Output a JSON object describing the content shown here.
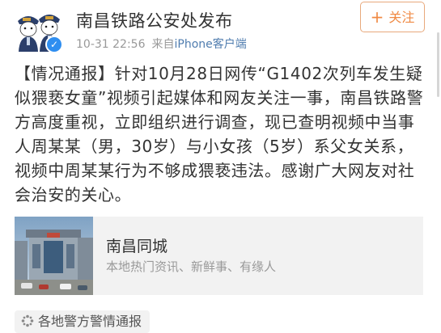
{
  "post": {
    "author_name": "南昌铁路公安处发布",
    "timestamp": "10-31 22:56",
    "source_prefix": "来自",
    "source_client": "iPhone客户端",
    "follow_label": "关注",
    "text": "【情况通报】针对10月28日网传“G1402次列车发生疑似猥亵女童”视频引起媒体和网友关注一事，南昌铁路警方高度重视，立即组织进行调查，现已查明视频中当事人周某某（男，30岁）与小女孩（5岁）系父女关系，视频中周某某行为不够成猥亵违法。感谢广大网友对社会治安的关心。"
  },
  "card": {
    "title": "南昌同城",
    "description": "本地热门资讯、新鲜事、有缘人"
  },
  "topic_tag": {
    "label": "各地警方警情通报",
    "icon": "flower-dots-icon"
  },
  "colors": {
    "follow_orange": "#f08a44",
    "verified_blue": "#2f8ef0",
    "link_blue": "#507daf",
    "meta_gray": "#999999"
  }
}
